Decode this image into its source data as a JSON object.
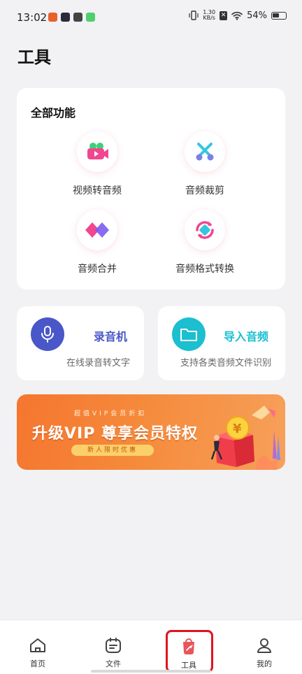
{
  "status_bar": {
    "time": "13:02",
    "speed_value": "1.30",
    "speed_unit": "KB/s",
    "battery": "54%"
  },
  "page": {
    "title": "工具"
  },
  "features": {
    "title": "全部功能",
    "items": [
      {
        "label": "视频转音频",
        "icon": "video-to-audio-icon"
      },
      {
        "label": "音频裁剪",
        "icon": "scissors-icon"
      },
      {
        "label": "音频合并",
        "icon": "merge-icon"
      },
      {
        "label": "音频格式转换",
        "icon": "format-convert-icon"
      }
    ]
  },
  "recorder": {
    "title": "录音机",
    "subtitle": "在线录音转文字",
    "icon": "microphone-icon",
    "color": "#4a57c8"
  },
  "importer": {
    "title": "导入音频",
    "subtitle": "支持各类音频文件识别",
    "icon": "folder-icon",
    "color": "#1bbfcf"
  },
  "banner": {
    "small_text": "超值VIP会员折扣",
    "title": "升级VIP 尊享会员特权",
    "pill": "新人限时优惠"
  },
  "bottom_nav": {
    "items": [
      {
        "label": "首页",
        "icon": "home-icon"
      },
      {
        "label": "文件",
        "icon": "file-icon"
      },
      {
        "label": "工具",
        "icon": "tool-icon",
        "active": true
      },
      {
        "label": "我的",
        "icon": "profile-icon"
      }
    ]
  },
  "colors": {
    "accent": "#e8565a",
    "highlight_frame": "#e0141e",
    "background": "#f2f2f4"
  }
}
